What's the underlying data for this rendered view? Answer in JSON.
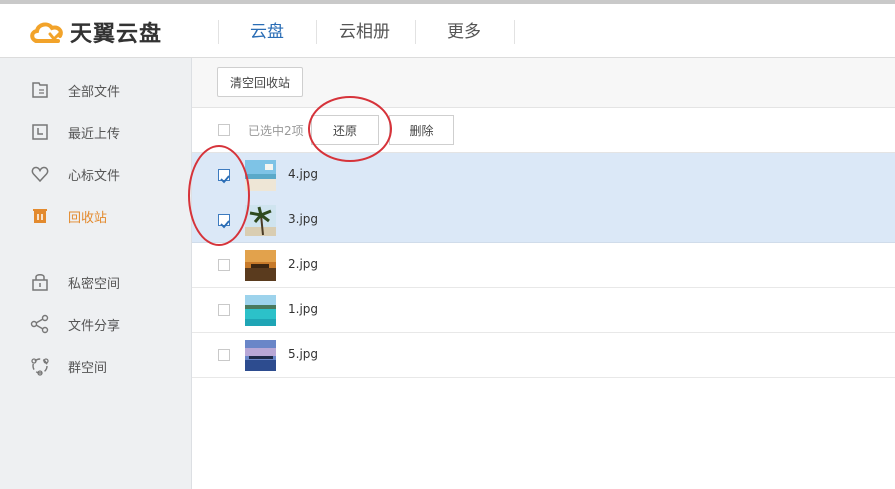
{
  "app": {
    "logo_text": "天翼云盘"
  },
  "nav": {
    "tabs": [
      "云盘",
      "云相册",
      "更多"
    ],
    "active": "云盘"
  },
  "sidebar": {
    "items": [
      {
        "label": "全部文件",
        "icon": "folder-icon"
      },
      {
        "label": "最近上传",
        "icon": "clock-icon"
      },
      {
        "label": "心标文件",
        "icon": "heart-icon"
      },
      {
        "label": "回收站",
        "icon": "trash-icon",
        "active": true
      },
      {
        "label": "私密空间",
        "icon": "lock-icon"
      },
      {
        "label": "文件分享",
        "icon": "share-icon"
      },
      {
        "label": "群空间",
        "icon": "group-icon"
      }
    ]
  },
  "toolbar": {
    "empty_recycle": "清空回收站"
  },
  "selection": {
    "summary": "已选中2项",
    "restore": "还原",
    "delete": "删除"
  },
  "files": [
    {
      "name": "4.jpg",
      "checked": true
    },
    {
      "name": "3.jpg",
      "checked": true
    },
    {
      "name": "2.jpg",
      "checked": false
    },
    {
      "name": "1.jpg",
      "checked": false
    },
    {
      "name": "5.jpg",
      "checked": false
    }
  ],
  "colors": {
    "accent_blue": "#2a6db5",
    "active_orange": "#e38a2e",
    "selected_row": "#dbe8f7",
    "annotation_red": "#d6333a"
  }
}
